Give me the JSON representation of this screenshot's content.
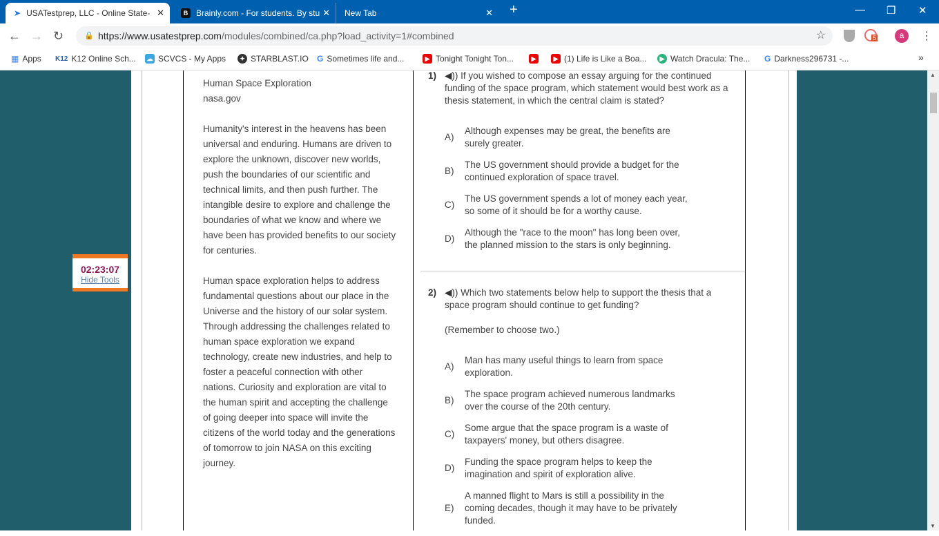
{
  "browser": {
    "tabs": [
      {
        "title": "USATestprep, LLC - Online State-"
      },
      {
        "title": "Brainly.com - For students. By stu"
      },
      {
        "title": "New Tab"
      }
    ],
    "url_host": "https://www.usatestprep.com",
    "url_path": "/modules/combined/ca.php?load_activity=1#combined",
    "extension_badge": "5",
    "profile_initial": "a",
    "bookmarks": [
      "Apps",
      "K12 Online Sch...",
      "SCVCS - My Apps",
      "STARBLAST.IO",
      "Sometimes life and...",
      "Tonight Tonight Ton...",
      "",
      "(1) Life is Like a Boa...",
      "Watch Dracula: The...",
      "Darkness296731 -..."
    ],
    "bookmarks_overflow": "»"
  },
  "timer": {
    "time": "02:23:07",
    "hide_label": "Hide Tools"
  },
  "passage": {
    "title": "Human Space Exploration",
    "source": "nasa.gov",
    "paragraphs": [
      "Humanity's interest in the heavens has been universal and enduring. Humans are driven to explore the unknown, discover new worlds, push the boundaries of our scientific and technical limits, and then push further. The intangible desire to explore and challenge the boundaries of what we know and where we have been has provided benefits to our society for centuries.",
      "Human space exploration helps to address fundamental questions about our place in the Universe and the history of our solar system. Through addressing the challenges related to human space exploration we expand technology, create new industries, and help to foster a peaceful connection with other nations. Curiosity and exploration are vital to the human spirit and accepting the challenge of going deeper into space will invite the citizens of the world today and the generations of tomorrow to join NASA on this exciting journey."
    ]
  },
  "questions": [
    {
      "number": "1)",
      "text": "If you wished to compose an essay arguing for the continued funding of the space program, which statement would best work as a thesis statement, in which the central claim is stated?",
      "note": "",
      "options": [
        {
          "letter": "A)",
          "text": "Although expenses may be great, the benefits are surely greater."
        },
        {
          "letter": "B)",
          "text": "The US government should provide a budget for the continued exploration of space travel."
        },
        {
          "letter": "C)",
          "text": "The US government spends a lot of money each year, so some of it should be for a worthy cause."
        },
        {
          "letter": "D)",
          "text": "Although the \"race to the moon\" has long been over, the planned mission to the stars is only beginning."
        }
      ]
    },
    {
      "number": "2)",
      "text": "Which two statements below help to support the thesis that a space program should continue to get funding?",
      "note": "(Remember to choose two.)",
      "options": [
        {
          "letter": "A)",
          "text": "Man has many useful things to learn from space exploration."
        },
        {
          "letter": "B)",
          "text": "The space program achieved numerous landmarks over the course of the 20th century."
        },
        {
          "letter": "C)",
          "text": "Some argue that the space program is a waste of taxpayers' money, but others disagree."
        },
        {
          "letter": "D)",
          "text": "Funding the space program helps to keep the imagination and spirit of exploration alive."
        },
        {
          "letter": "E)",
          "text": "A manned flight to Mars is still a possibility in the coming decades, though it may have to be privately funded."
        }
      ]
    }
  ]
}
